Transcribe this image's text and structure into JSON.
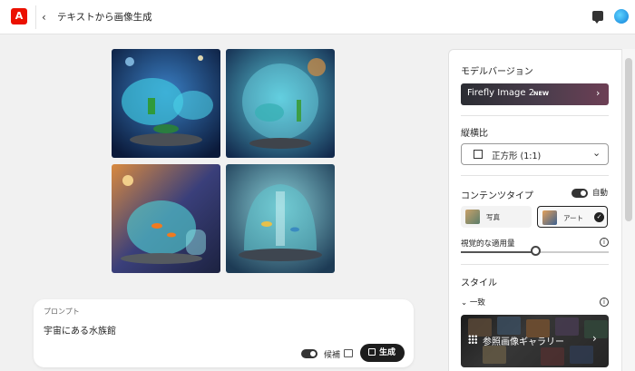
{
  "header": {
    "logo_letter": "A",
    "back": "‹",
    "title": "テキストから画像生成"
  },
  "images": [
    {
      "theme": "aquarium bowl in space, blue"
    },
    {
      "theme": "glass sphere aquarium, nebula"
    },
    {
      "theme": "fish tank with goldfish, galaxy"
    },
    {
      "theme": "domed aquarium, teal space"
    }
  ],
  "prompt": {
    "label": "プロンプト",
    "text": "宇宙にある水族館",
    "suggest_label": "候補",
    "generate_label": "生成",
    "suggest_on": true
  },
  "settings": {
    "model_version": {
      "heading": "モデルバージョン",
      "name": "Firefly Image 2",
      "badge": "NEW",
      "chevron": "›"
    },
    "aspect_ratio": {
      "heading": "縦横比",
      "value": "正方形 (1:1)",
      "chevron": "⌄"
    },
    "content_type": {
      "heading": "コンテンツタイプ",
      "auto_label": "自動",
      "auto_on": true,
      "options": [
        {
          "label": "写真",
          "selected": false
        },
        {
          "label": "アート",
          "selected": true
        }
      ]
    },
    "visual_intensity": {
      "label": "視覚的な適用量",
      "info": "i",
      "level": 0.5
    },
    "style": {
      "heading": "スタイル",
      "subgroup": "一致",
      "subgroup_chevron": "⌄",
      "info": "i",
      "gallery_label": "参照画像ギャラリー",
      "gallery_chevron": "›"
    }
  },
  "colors": {
    "adobe_red": "#eb1000",
    "dark": "#1d1d1d"
  }
}
